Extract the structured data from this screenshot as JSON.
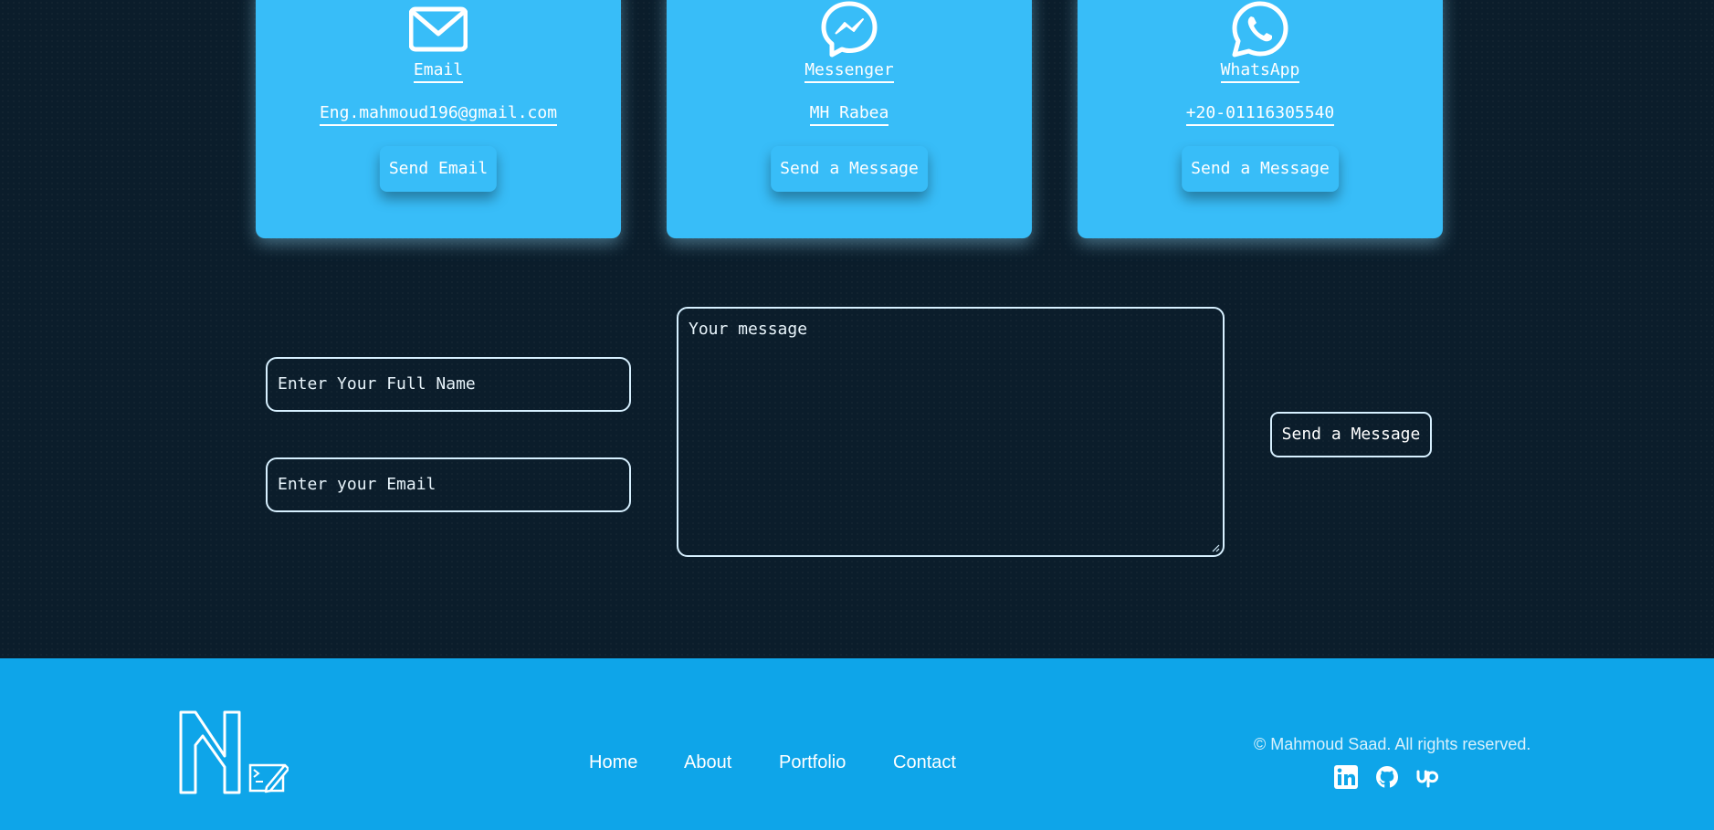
{
  "contact_cards": [
    {
      "title": "Email",
      "value": "Eng.mahmoud196@gmail.com",
      "button": "Send Email",
      "icon": "mail-icon"
    },
    {
      "title": "Messenger",
      "value": "MH Rabea",
      "button": "Send a Message",
      "icon": "messenger-icon"
    },
    {
      "title": "WhatsApp",
      "value": "+20-01116305540",
      "button": "Send a Message",
      "icon": "whatsapp-icon"
    }
  ],
  "form": {
    "name_placeholder": "Enter Your Full Name",
    "email_placeholder": "Enter your Email",
    "message_placeholder": "Your message",
    "submit_label": "Send a Message"
  },
  "footer": {
    "nav": [
      "Home",
      "About",
      "Portfolio",
      "Contact"
    ],
    "copyright": "© Mahmoud Saad. All rights reserved.",
    "social_icons": [
      "linkedin-icon",
      "github-icon",
      "upwork-icon"
    ]
  },
  "colors": {
    "background": "#0b1d2b",
    "card": "#38bdf8",
    "footer": "#0ea5e9",
    "border": "#d7f0ff"
  }
}
